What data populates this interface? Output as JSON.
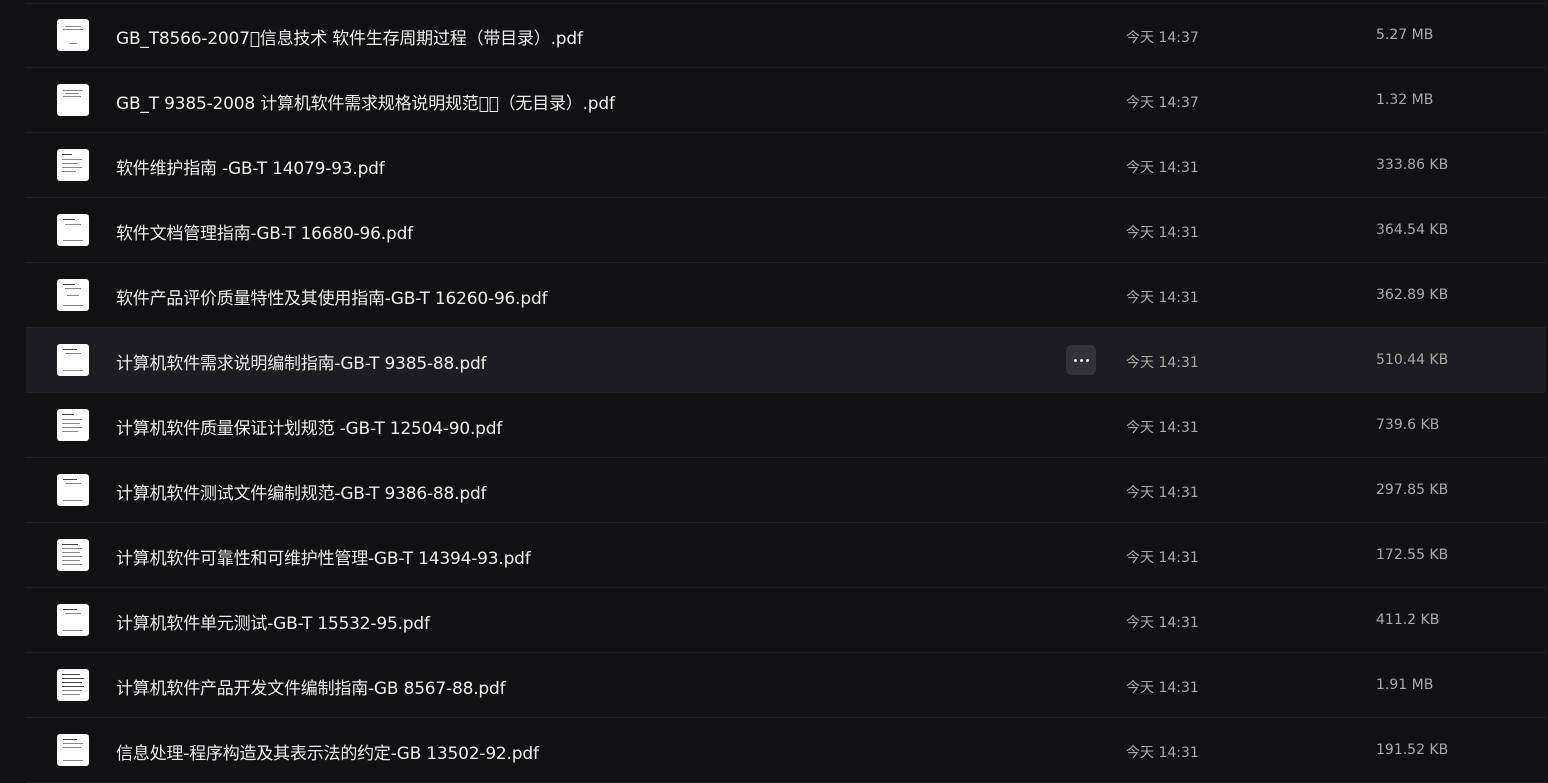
{
  "files": [
    {
      "name": "GB_T8566-2007\u0000信息技术 软件生存周期过程（带目录）.pdf",
      "time": "今天 14:37",
      "size": "5.27 MB"
    },
    {
      "name": "GB_T 9385-2008 计算机软件需求规格说明规范\u0000\u0000（无目录）.pdf",
      "time": "今天 14:37",
      "size": "1.32 MB"
    },
    {
      "name": "软件维护指南 -GB-T 14079-93.pdf",
      "time": "今天 14:31",
      "size": "333.86 KB"
    },
    {
      "name": "软件文档管理指南-GB-T 16680-96.pdf",
      "time": "今天 14:31",
      "size": "364.54 KB"
    },
    {
      "name": "软件产品评价质量特性及其使用指南-GB-T 16260-96.pdf",
      "time": "今天 14:31",
      "size": "362.89 KB"
    },
    {
      "name": "计算机软件需求说明编制指南-GB-T 9385-88.pdf",
      "time": "今天 14:31",
      "size": "510.44 KB"
    },
    {
      "name": "计算机软件质量保证计划规范 -GB-T 12504-90.pdf",
      "time": "今天 14:31",
      "size": "739.6 KB"
    },
    {
      "name": "计算机软件测试文件编制规范-GB-T 9386-88.pdf",
      "time": "今天 14:31",
      "size": "297.85 KB"
    },
    {
      "name": "计算机软件可靠性和可维护性管理-GB-T 14394-93.pdf",
      "time": "今天 14:31",
      "size": "172.55 KB"
    },
    {
      "name": "计算机软件单元测试-GB-T 15532-95.pdf",
      "time": "今天 14:31",
      "size": "411.2 KB"
    },
    {
      "name": "计算机软件产品开发文件编制指南-GB 8567-88.pdf",
      "time": "今天 14:31",
      "size": "1.91 MB"
    },
    {
      "name": "信息处理-程序构造及其表示法的约定-GB 13502-92.pdf",
      "time": "今天 14:31",
      "size": "191.52 KB"
    }
  ],
  "more_icon": "more-horizontal-icon",
  "thumbnail_icon": "pdf-thumbnail-icon"
}
